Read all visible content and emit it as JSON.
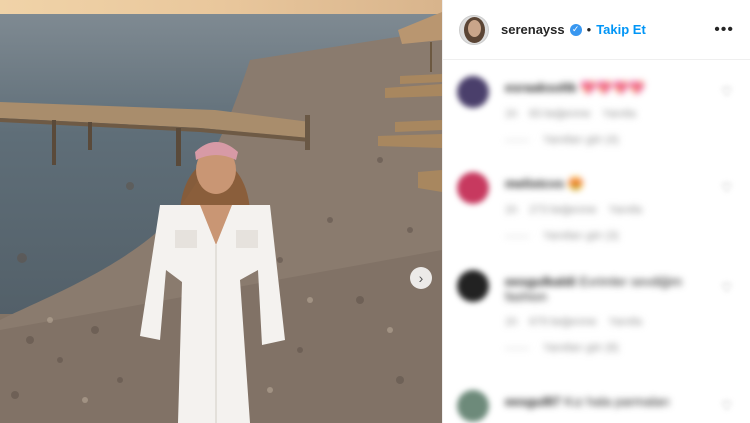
{
  "post": {
    "username": "serenayss",
    "separator": "•",
    "follow_label": "Takip Et",
    "more_label": "•••",
    "verified_glyph": "✓",
    "next_arrow": "›"
  },
  "comments": [
    {
      "username": "esraaksoltk",
      "text": "💖💖💖💖",
      "time": "1h",
      "likes": "83 beğenme",
      "reply": "Yanıtla",
      "view_replies": "Yanıtları gör (4)",
      "avatar_color": "#4a3f6b"
    },
    {
      "username": "melistcvs",
      "text": "😍",
      "time": "1h",
      "likes": "273 beğenme",
      "reply": "Yanıtla",
      "view_replies": "Yanıtları gör (3)",
      "avatar_color": "#c7395f"
    },
    {
      "username": "eesgulkaldi",
      "text": "Evrimler sevdiğim",
      "text2": "fashion",
      "time": "1h",
      "likes": "679 beğenme",
      "reply": "Yanıtla",
      "view_replies": "Yanıtları gör (8)",
      "avatar_color": "#222222"
    },
    {
      "username": "eesgul87",
      "text": "Kız hala parmaları",
      "time": "",
      "likes": "",
      "reply": "",
      "view_replies": "",
      "avatar_color": "#6d8a7a"
    }
  ],
  "icons": {
    "heart": "♡"
  }
}
